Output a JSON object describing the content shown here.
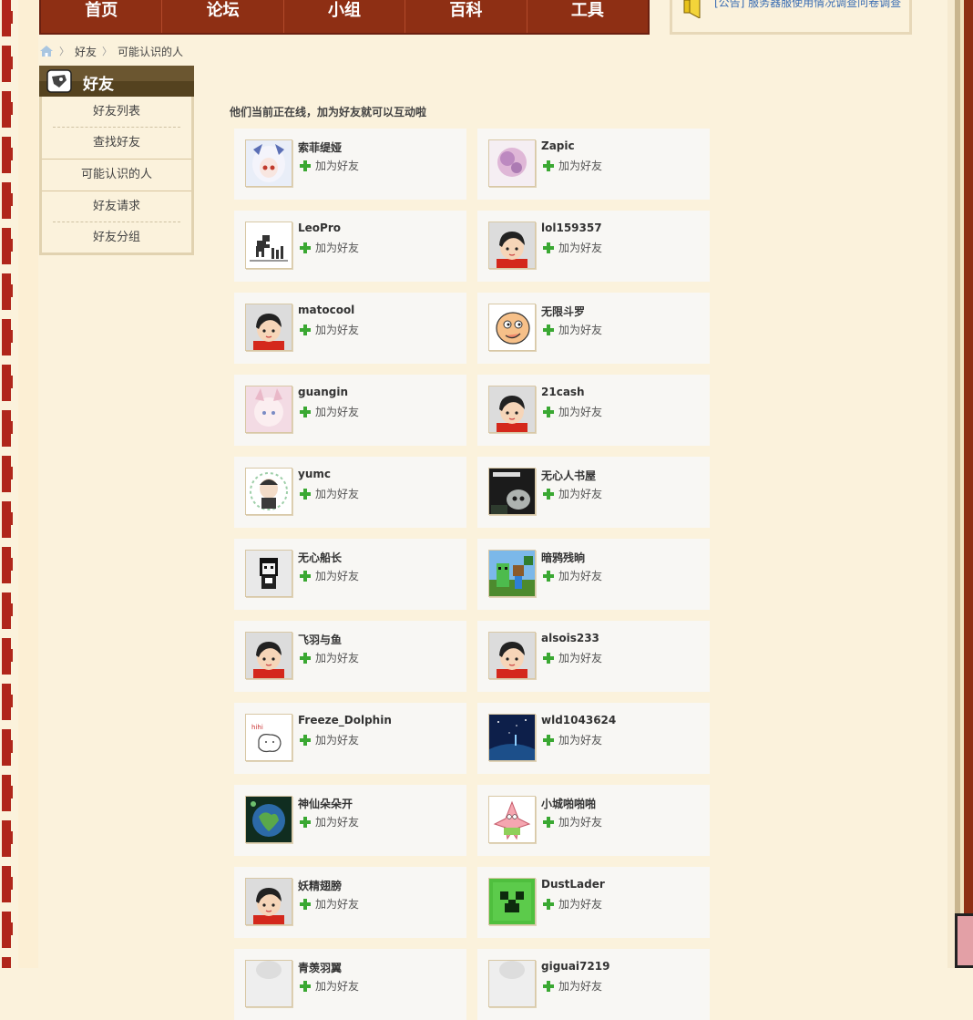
{
  "nav": {
    "items": [
      "首页",
      "论坛",
      "小组",
      "百科",
      "工具"
    ]
  },
  "notice": {
    "text": "[公告] 服务器服使用情况调查问卷调查"
  },
  "breadcrumb": {
    "items": [
      "好友",
      "可能认识的人"
    ]
  },
  "sidebar": {
    "title": "好友",
    "items": [
      "好友列表",
      "查找好友",
      "可能认识的人",
      "好友请求",
      "好友分组"
    ]
  },
  "content": {
    "title": "他们当前正在线，加为好友就可以互动啦",
    "add_label": "加为好友",
    "friends": [
      {
        "name": "索菲缇娅",
        "avatar": "anime-girl-avatar"
      },
      {
        "name": "Zapic",
        "avatar": "purple-blur-avatar"
      },
      {
        "name": "LeoPro",
        "avatar": "dinosaur-avatar"
      },
      {
        "name": "lol159357",
        "avatar": "default-boy-avatar"
      },
      {
        "name": "matocool",
        "avatar": "default-boy-avatar"
      },
      {
        "name": "无限斗罗",
        "avatar": "cartoon-face-avatar"
      },
      {
        "name": "guangin",
        "avatar": "anime-cat-girl-avatar"
      },
      {
        "name": "21cash",
        "avatar": "default-boy-avatar"
      },
      {
        "name": "yumc",
        "avatar": "chibi-boy-avatar"
      },
      {
        "name": "无心人书屋",
        "avatar": "mojang-skull-avatar"
      },
      {
        "name": "无心船长",
        "avatar": "pixel-character-avatar"
      },
      {
        "name": "暗鸦残晌",
        "avatar": "minecraft-scene-avatar"
      },
      {
        "name": "飞羽与鱼",
        "avatar": "default-boy-avatar"
      },
      {
        "name": "alsois233",
        "avatar": "default-boy-avatar"
      },
      {
        "name": "Freeze_Dolphin",
        "avatar": "doodle-avatar"
      },
      {
        "name": "wld1043624",
        "avatar": "night-sky-avatar"
      },
      {
        "name": "神仙朵朵开",
        "avatar": "earth-heart-avatar"
      },
      {
        "name": "小城啪啪啪",
        "avatar": "patrick-avatar"
      },
      {
        "name": "妖精翅膀",
        "avatar": "default-boy-avatar"
      },
      {
        "name": "DustLader",
        "avatar": "creeper-avatar"
      },
      {
        "name": "青羡羽翼",
        "avatar": "partial-avatar"
      },
      {
        "name": "giguai7219",
        "avatar": "partial-avatar"
      }
    ]
  },
  "colors": {
    "nav_bg": "#8e2f14",
    "page_bg": "#fbf2dc",
    "card_bg": "#f8f7f4",
    "plus": "#3aa832",
    "link": "#3a6db3"
  }
}
